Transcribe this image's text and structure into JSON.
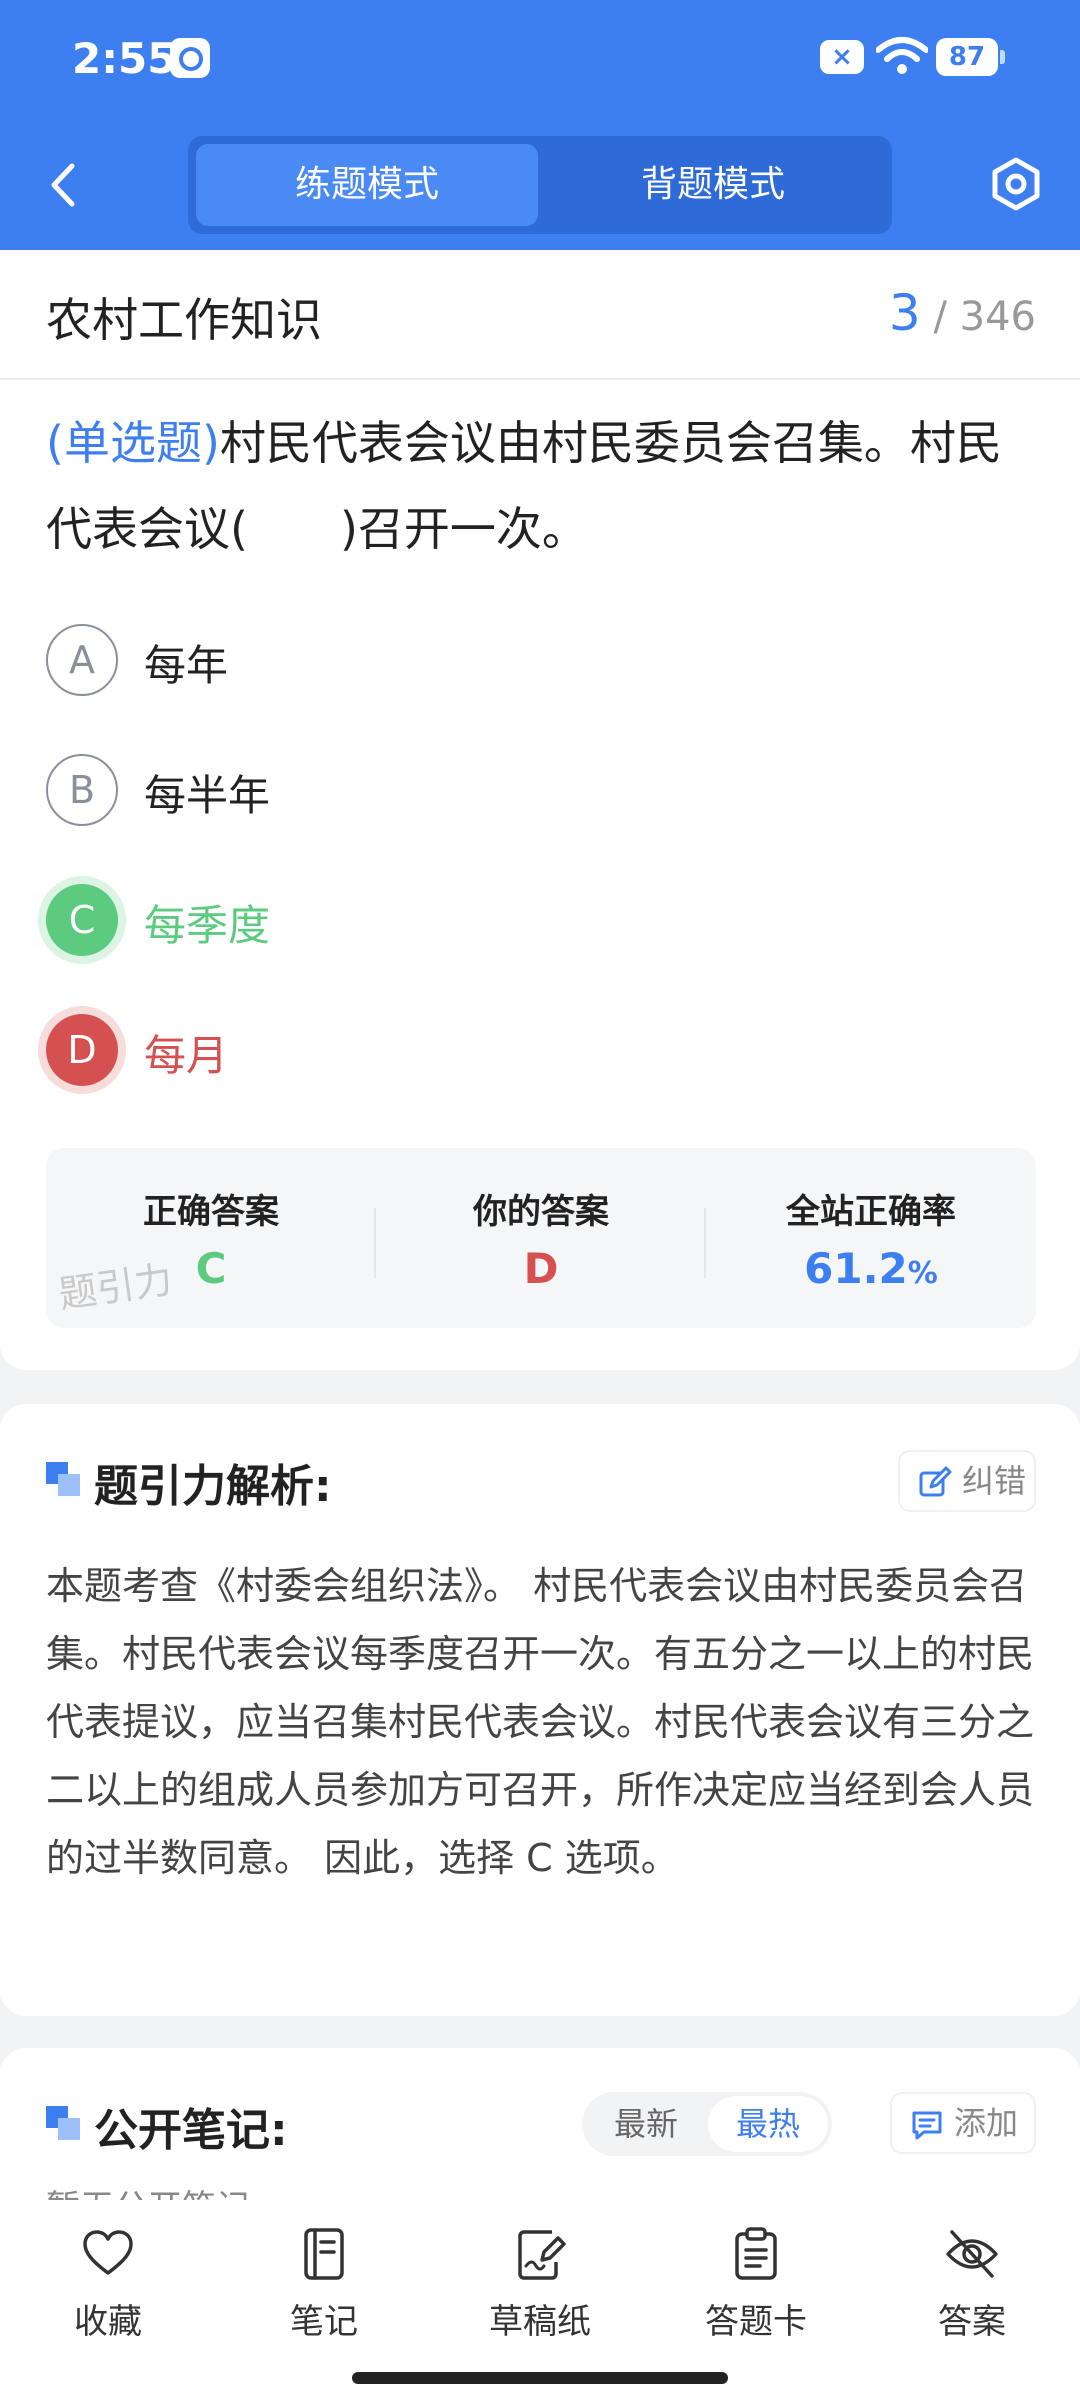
{
  "status_bar": {
    "time": "2:55",
    "battery": "87",
    "sim_icon": "×"
  },
  "header": {
    "modes": [
      "练题模式",
      "背题模式"
    ],
    "active_mode": "练题模式",
    "accent_color": "#3d7ff0"
  },
  "question": {
    "subject": "农村工作知识",
    "current": "3",
    "total": "/ 346",
    "type_label": "(单选题)",
    "text": "村民代表会议由村民委员会召集。村民代表会议(　　)召开一次。",
    "options": [
      {
        "letter": "A",
        "text": "每年",
        "state": "normal"
      },
      {
        "letter": "B",
        "text": "每半年",
        "state": "normal"
      },
      {
        "letter": "C",
        "text": "每季度",
        "state": "correct"
      },
      {
        "letter": "D",
        "text": "每月",
        "state": "wrong"
      }
    ],
    "stats": {
      "correct_title": "正确答案",
      "correct_value": "C",
      "yours_title": "你的答案",
      "yours_value": "D",
      "rate_title": "全站正确率",
      "rate_value": "61.2",
      "rate_unit": "%",
      "watermark": "题引力"
    },
    "colors": {
      "correct": "#5ccb7f",
      "wrong": "#d55151"
    }
  },
  "analysis": {
    "title": "题引力解析:",
    "report_label": "纠错",
    "text": "本题考查《村委会组织法》。 村民代表会议由村民委员会召集。村民代表会议每季度召开一次。有五分之一以上的村民代表提议，应当召集村民代表会议。村民代表会议有三分之二以上的组成人员参加方可召开，所作决定应当经到会人员的过半数同意。 因此，选择 C 选项。"
  },
  "notes": {
    "title": "公开笔记:",
    "sort_options": [
      "最新",
      "最热"
    ],
    "active_sort": "最热",
    "add_label": "添加",
    "empty_text": "暂无公开笔记"
  },
  "bottom_nav": [
    {
      "label": "收藏",
      "icon": "heart-icon"
    },
    {
      "label": "笔记",
      "icon": "notebook-icon"
    },
    {
      "label": "草稿纸",
      "icon": "draft-icon"
    },
    {
      "label": "答题卡",
      "icon": "answer-sheet-icon"
    },
    {
      "label": "答案",
      "icon": "eye-off-icon"
    }
  ]
}
